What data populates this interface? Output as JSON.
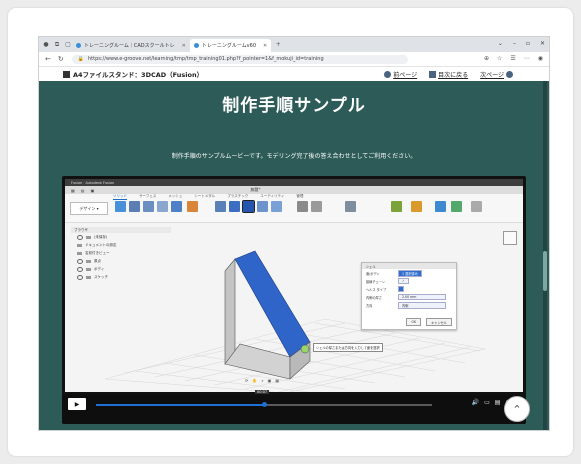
{
  "browser": {
    "tabs": [
      {
        "label": "トレーニングルーム｜CADスクールトレ"
      },
      {
        "label": "トレーニングルームv60"
      }
    ],
    "new_tab": "+",
    "url": "https://www.e-groove.net/learning/tmp/tmp_training01.php?f_pointer=1&f_mokuji_id=training"
  },
  "site": {
    "title": "A4ファイルスタンド：3DCAD（Fusion）",
    "nav": {
      "prev": "前ページ",
      "index": "目次に戻る",
      "next": "次ページ"
    }
  },
  "page": {
    "heading": "制作手順サンプル",
    "description": "制作手順のサンプルムービーです。モデリング完了後の答え合わせとしてご利用ください。"
  },
  "video": {
    "app_title": "Fusion · Autodesk Fusion",
    "doc_tab": "無題*",
    "design_button": "デザイン ▾",
    "ribbon_tabs": [
      "ソリッド",
      "サーフェス",
      "メッシュ",
      "シートメタル",
      "プラスチック",
      "ユーティリティ",
      "管理"
    ],
    "ribbon_groups": [
      "作成▾",
      "自動化▾",
      "修正▾",
      "アセンブリ▾",
      "コンストラクション▾",
      "検査▾",
      "挿入▾",
      "選択▾"
    ],
    "browser_panel": {
      "header": "ブラウザ",
      "items": [
        "(未保存)",
        "ドキュメントの設定",
        "名前付きビュー",
        "原点",
        "ボディ",
        "スケッチ"
      ]
    },
    "dialog": {
      "title": "シェル",
      "rows": [
        {
          "label": "面/ボディ",
          "value": "1 選択済み"
        },
        {
          "label": "接線チェーン",
          "value": "✓"
        },
        {
          "label": "ヘルス タイプ",
          "value": ""
        },
        {
          "label": "内側の厚さ",
          "value": "2.00 mm"
        },
        {
          "label": "方向",
          "value": "内側"
        }
      ],
      "ok": "OK",
      "cancel": "キャンセル"
    },
    "tooltip": "シェルの厚さまたは方向を入力して面を選択",
    "time": "00:07"
  },
  "colors": {
    "page_bg": "#2d5b58",
    "model_blue": "#2f64c8",
    "progress_blue": "#1e6fd6"
  },
  "progress": 0.5
}
